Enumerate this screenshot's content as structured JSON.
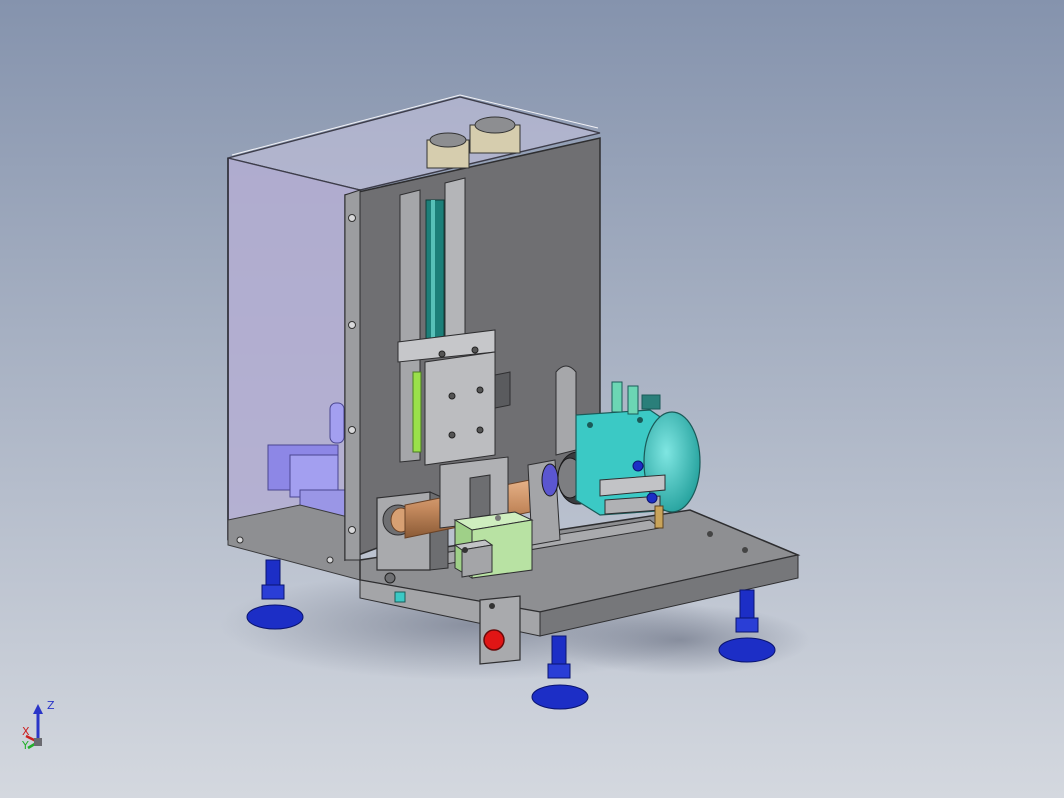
{
  "viewport": {
    "background_top": "#8593ad",
    "background_bottom": "#d4d8df"
  },
  "model": {
    "colors": {
      "enclosure_glass": "#b4aed2",
      "steel_plate": "#8e8f92",
      "steel_plate_light": "#a4a5a8",
      "steel_dark": "#636467",
      "rail_teal": "#1c7f79",
      "cylinder_cyan": "#3bc9c5",
      "fitting_green": "#6cd6b4",
      "leveling_foot_blue": "#1c2ec6",
      "motor_lavender": "#8d87e6",
      "copper_shaft": "#c58a5e",
      "fixture_green": "#b8e2a3",
      "stop_button_red": "#e01515",
      "cap_tan": "#d6cdae"
    }
  },
  "triad": {
    "z_label": "Z",
    "x_label": "X",
    "y_label": "Y",
    "z_color": "#2a35c8",
    "x_color": "#cc2020",
    "y_color": "#22b02a"
  }
}
